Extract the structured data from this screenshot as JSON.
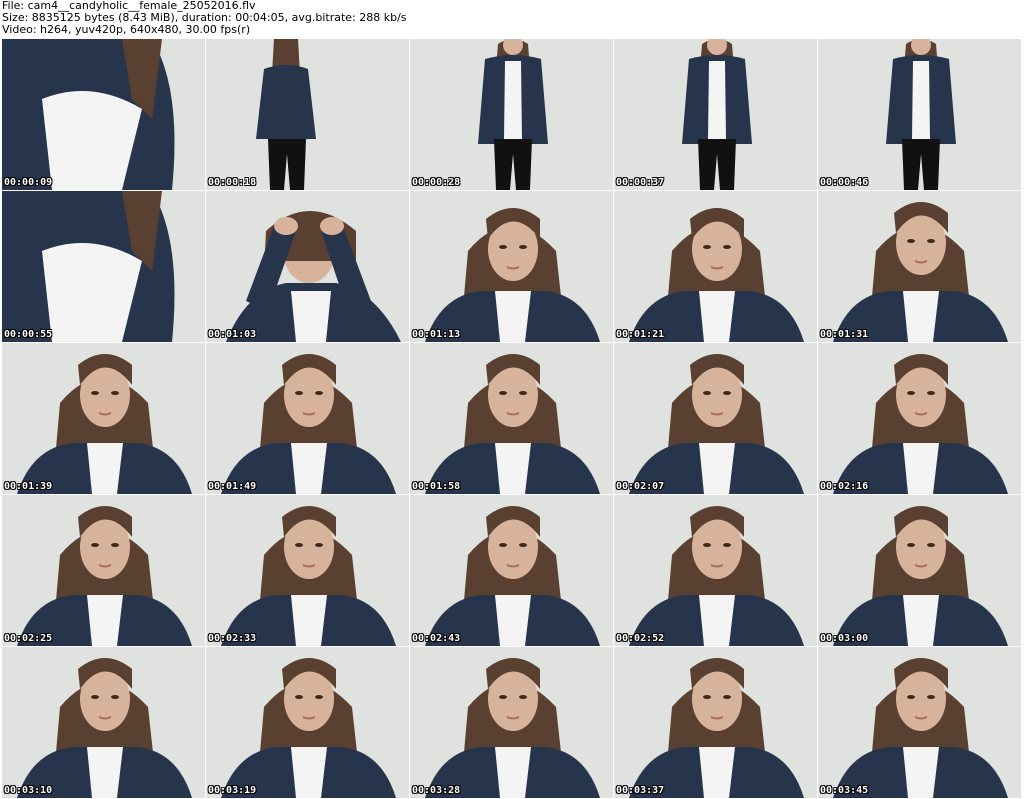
{
  "header": {
    "file_line": "File: cam4__candyholic__female_25052016.flv",
    "size_line": "Size: 8835125 bytes (8.43 MiB), duration: 00:04:05, avg.bitrate: 288 kb/s",
    "video_line": "Video: h264, yuv420p, 640x480, 30.00 fps(r)"
  },
  "colors": {
    "wall": "#dfe2de",
    "jacket": "#26344c",
    "shirt": "#f4f4f4",
    "hair": "#5a4030",
    "skin": "#d7b39c",
    "pants": "#111111"
  },
  "thumbnails": [
    {
      "timestamp": "00:00:09",
      "scene": "closeup-motion"
    },
    {
      "timestamp": "00:00:18",
      "scene": "back-view"
    },
    {
      "timestamp": "00:00:28",
      "scene": "full-body"
    },
    {
      "timestamp": "00:00:37",
      "scene": "full-body"
    },
    {
      "timestamp": "00:00:46",
      "scene": "full-body"
    },
    {
      "timestamp": "00:00:55",
      "scene": "closeup-motion"
    },
    {
      "timestamp": "00:01:03",
      "scene": "hands-on-head"
    },
    {
      "timestamp": "00:01:13",
      "scene": "portrait-down"
    },
    {
      "timestamp": "00:01:21",
      "scene": "portrait-down"
    },
    {
      "timestamp": "00:01:31",
      "scene": "portrait"
    },
    {
      "timestamp": "00:01:39",
      "scene": "portrait"
    },
    {
      "timestamp": "00:01:49",
      "scene": "portrait"
    },
    {
      "timestamp": "00:01:58",
      "scene": "portrait"
    },
    {
      "timestamp": "00:02:07",
      "scene": "portrait"
    },
    {
      "timestamp": "00:02:16",
      "scene": "portrait"
    },
    {
      "timestamp": "00:02:25",
      "scene": "portrait"
    },
    {
      "timestamp": "00:02:33",
      "scene": "portrait"
    },
    {
      "timestamp": "00:02:43",
      "scene": "portrait"
    },
    {
      "timestamp": "00:02:52",
      "scene": "portrait"
    },
    {
      "timestamp": "00:03:00",
      "scene": "portrait"
    },
    {
      "timestamp": "00:03:10",
      "scene": "portrait"
    },
    {
      "timestamp": "00:03:19",
      "scene": "portrait"
    },
    {
      "timestamp": "00:03:28",
      "scene": "portrait"
    },
    {
      "timestamp": "00:03:37",
      "scene": "portrait"
    },
    {
      "timestamp": "00:03:45",
      "scene": "portrait"
    }
  ]
}
